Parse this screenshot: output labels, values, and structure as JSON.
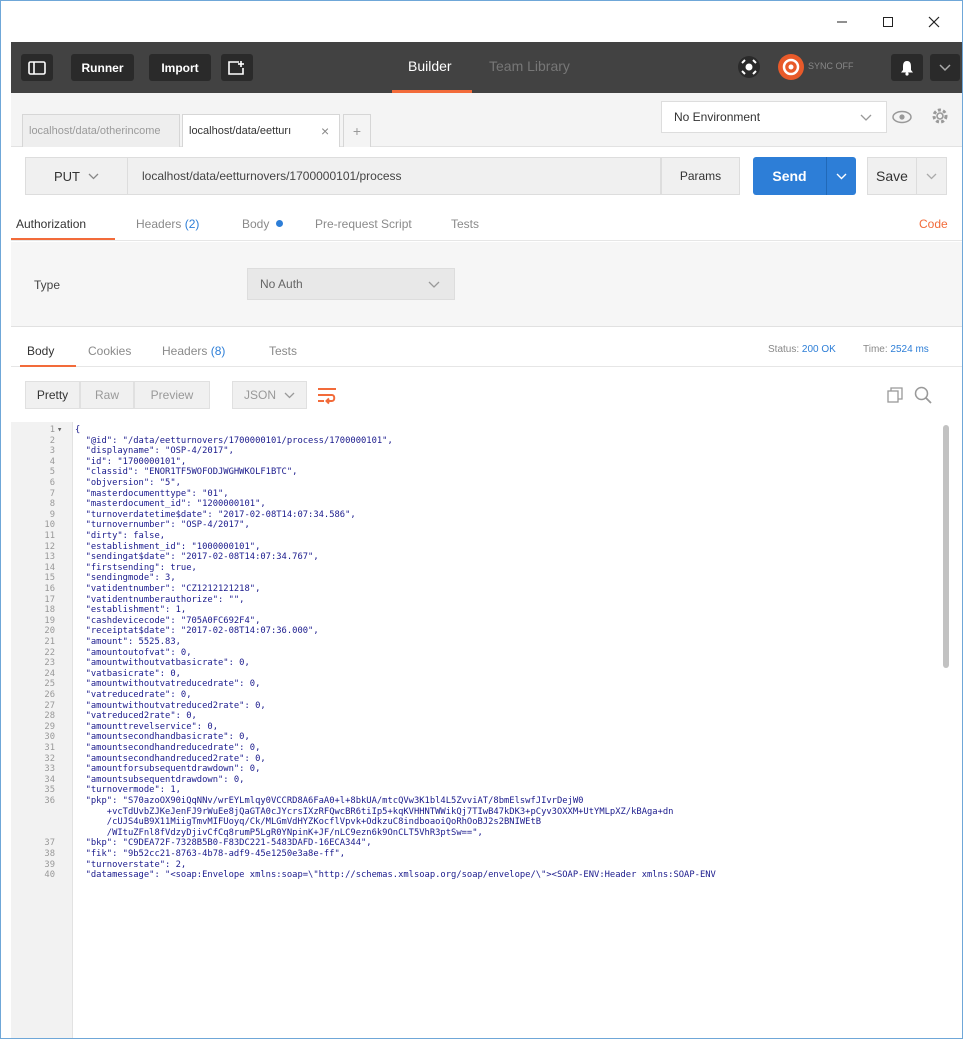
{
  "window": {
    "controls": [
      "—",
      "☐",
      "✕"
    ]
  },
  "toolbar": {
    "runner_label": "Runner",
    "import_label": "Import",
    "builder_tab": "Builder",
    "team_library_tab": "Team Library",
    "sync_label": "SYNC OFF"
  },
  "tabs": {
    "items": [
      {
        "label": "localhost/data/otherincome"
      },
      {
        "label": "localhost/data/eetturı"
      }
    ],
    "close": "×",
    "add": "+"
  },
  "environment": {
    "selected": "No Environment"
  },
  "request": {
    "method": "PUT",
    "url": "localhost/data/eetturnovers/1700000101/process",
    "params_label": "Params",
    "send_label": "Send",
    "save_label": "Save"
  },
  "request_tabs": {
    "authorization": "Authorization",
    "headers": "Headers",
    "headers_count": "(2)",
    "body": "Body",
    "prerequest": "Pre-request Script",
    "tests": "Tests",
    "code": "Code"
  },
  "auth": {
    "type_label": "Type",
    "type_value": "No Auth"
  },
  "response_tabs": {
    "body": "Body",
    "cookies": "Cookies",
    "headers": "Headers",
    "headers_count": "(8)",
    "tests": "Tests",
    "status_label": "Status:",
    "status_value": "200 OK",
    "time_label": "Time:",
    "time_value": "2524 ms"
  },
  "view": {
    "pretty": "Pretty",
    "raw": "Raw",
    "preview": "Preview",
    "format": "JSON"
  },
  "code_lines": [
    {
      "n": "1",
      "t": "{"
    },
    {
      "n": "2",
      "t": "  \"@id\": \"/data/eetturnovers/1700000101/process/1700000101\","
    },
    {
      "n": "3",
      "t": "  \"displayname\": \"OSP-4/2017\","
    },
    {
      "n": "4",
      "t": "  \"id\": \"1700000101\","
    },
    {
      "n": "5",
      "t": "  \"classid\": \"ENOR1TF5WOFODJWGHWKOLF1BTC\","
    },
    {
      "n": "6",
      "t": "  \"objversion\": \"5\","
    },
    {
      "n": "7",
      "t": "  \"masterdocumenttype\": \"01\","
    },
    {
      "n": "8",
      "t": "  \"masterdocument_id\": \"1200000101\","
    },
    {
      "n": "9",
      "t": "  \"turnoverdatetime$date\": \"2017-02-08T14:07:34.586\","
    },
    {
      "n": "10",
      "t": "  \"turnovernumber\": \"OSP-4/2017\","
    },
    {
      "n": "11",
      "t": "  \"dirty\": false,"
    },
    {
      "n": "12",
      "t": "  \"establishment_id\": \"1000000101\","
    },
    {
      "n": "13",
      "t": "  \"sendingat$date\": \"2017-02-08T14:07:34.767\","
    },
    {
      "n": "14",
      "t": "  \"firstsending\": true,"
    },
    {
      "n": "15",
      "t": "  \"sendingmode\": 3,"
    },
    {
      "n": "16",
      "t": "  \"vatidentnumber\": \"CZ1212121218\","
    },
    {
      "n": "17",
      "t": "  \"vatidentnumberauthorize\": \"\","
    },
    {
      "n": "18",
      "t": "  \"establishment\": 1,"
    },
    {
      "n": "19",
      "t": "  \"cashdevicecode\": \"705A0FC692F4\","
    },
    {
      "n": "20",
      "t": "  \"receiptat$date\": \"2017-02-08T14:07:36.000\","
    },
    {
      "n": "21",
      "t": "  \"amount\": 5525.83,"
    },
    {
      "n": "22",
      "t": "  \"amountoutofvat\": 0,"
    },
    {
      "n": "23",
      "t": "  \"amountwithoutvatbasicrate\": 0,"
    },
    {
      "n": "24",
      "t": "  \"vatbasicrate\": 0,"
    },
    {
      "n": "25",
      "t": "  \"amountwithoutvatreducedrate\": 0,"
    },
    {
      "n": "26",
      "t": "  \"vatreducedrate\": 0,"
    },
    {
      "n": "27",
      "t": "  \"amountwithoutvatreduced2rate\": 0,"
    },
    {
      "n": "28",
      "t": "  \"vatreduced2rate\": 0,"
    },
    {
      "n": "29",
      "t": "  \"amounttrevelservice\": 0,"
    },
    {
      "n": "30",
      "t": "  \"amountsecondhandbasicrate\": 0,"
    },
    {
      "n": "31",
      "t": "  \"amountsecondhandreducedrate\": 0,"
    },
    {
      "n": "32",
      "t": "  \"amountsecondhandreduced2rate\": 0,"
    },
    {
      "n": "33",
      "t": "  \"amountforsubsequentdrawdown\": 0,"
    },
    {
      "n": "34",
      "t": "  \"amountsubsequentdrawdown\": 0,"
    },
    {
      "n": "35",
      "t": "  \"turnovermode\": 1,"
    },
    {
      "n": "36",
      "t": "  \"pkp\": \"S70azoOX90iQqNNv/wrEYLmlqy0VCCRD8A6FaA0+l+8bkUA/mtcQVw3K1bl4L5ZvviAT/8bmElswfJIvrDejW0"
    },
    {
      "n": "",
      "t": "      +vcTdUvbZJKeJenFJ9rWuEe8jQaGTA0cJYcrsIXzRFQwcBR6tiIp5+kqKVHHNTWWikQj7TIwB47kDK3+pCyv3OXXM+UtYMLpXZ/kBAga+dn"
    },
    {
      "n": "",
      "t": "      /cUJS4uB9X11MiigTmvMIFUoyq/Ck/MLGmVdHYZKocflVpvk+OdkzuC8indboaoiQoRhOoBJ2s2BNIWEtB"
    },
    {
      "n": "",
      "t": "      /WItuZFnl8fVdzyDjivCfCq8rumP5LgR0YNpinK+JF/nLC9ezn6k9OnCLT5VhR3ptSw==\","
    },
    {
      "n": "37",
      "t": "  \"bkp\": \"C9DEA72F-7328B5B0-F83DC221-5483DAFD-16ECA344\","
    },
    {
      "n": "38",
      "t": "  \"fik\": \"9b52cc21-8763-4b78-adf9-45e1250e3a8e-ff\","
    },
    {
      "n": "39",
      "t": "  \"turnoverstate\": 2,"
    },
    {
      "n": "40",
      "t": "  \"datamessage\": \"<soap:Envelope xmlns:soap=\\\"http://schemas.xmlsoap.org/soap/envelope/\\\"><SOAP-ENV:Header xmlns:SOAP-ENV"
    }
  ]
}
